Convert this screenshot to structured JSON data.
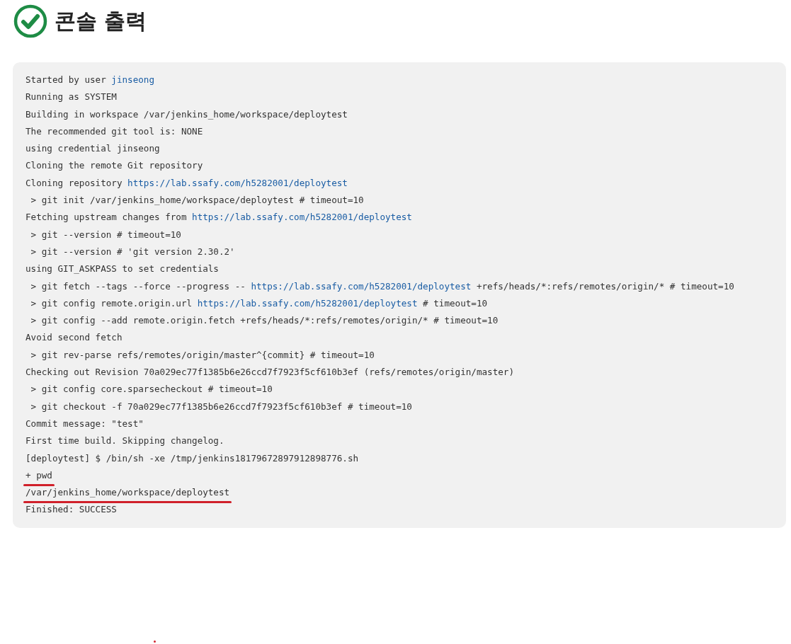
{
  "header": {
    "title": "콘솔 출력",
    "kind": "success"
  },
  "console": {
    "lines": [
      {
        "segments": [
          {
            "kind": "text",
            "text": "Started by user "
          },
          {
            "kind": "link",
            "text": "jinseong"
          }
        ],
        "underlined": false
      },
      {
        "segments": [
          {
            "kind": "text",
            "text": "Running as SYSTEM"
          }
        ],
        "underlined": false
      },
      {
        "segments": [
          {
            "kind": "text",
            "text": "Building in workspace /var/jenkins_home/workspace/deploytest"
          }
        ],
        "underlined": false
      },
      {
        "segments": [
          {
            "kind": "text",
            "text": "The recommended git tool is: NONE"
          }
        ],
        "underlined": false
      },
      {
        "segments": [
          {
            "kind": "text",
            "text": "using credential jinseong"
          }
        ],
        "underlined": false
      },
      {
        "segments": [
          {
            "kind": "text",
            "text": "Cloning the remote Git repository"
          }
        ],
        "underlined": false
      },
      {
        "segments": [
          {
            "kind": "text",
            "text": "Cloning repository "
          },
          {
            "kind": "link",
            "text": "https://lab.ssafy.com/h5282001/deploytest"
          }
        ],
        "underlined": false
      },
      {
        "segments": [
          {
            "kind": "text",
            "text": " > git init /var/jenkins_home/workspace/deploytest # timeout=10"
          }
        ],
        "underlined": false
      },
      {
        "segments": [
          {
            "kind": "text",
            "text": "Fetching upstream changes from "
          },
          {
            "kind": "link",
            "text": "https://lab.ssafy.com/h5282001/deploytest"
          }
        ],
        "underlined": false
      },
      {
        "segments": [
          {
            "kind": "text",
            "text": " > git --version # timeout=10"
          }
        ],
        "underlined": false
      },
      {
        "segments": [
          {
            "kind": "text",
            "text": " > git --version # 'git version 2.30.2'"
          }
        ],
        "underlined": false
      },
      {
        "segments": [
          {
            "kind": "text",
            "text": "using GIT_ASKPASS to set credentials"
          }
        ],
        "underlined": false
      },
      {
        "segments": [
          {
            "kind": "text",
            "text": " > git fetch --tags --force --progress -- "
          },
          {
            "kind": "link",
            "text": "https://lab.ssafy.com/h5282001/deploytest"
          },
          {
            "kind": "text",
            "text": " +refs/heads/*:refs/remotes/origin/* # timeout=10"
          }
        ],
        "underlined": false
      },
      {
        "segments": [
          {
            "kind": "text",
            "text": " > git config remote.origin.url "
          },
          {
            "kind": "link",
            "text": "https://lab.ssafy.com/h5282001/deploytest"
          },
          {
            "kind": "text",
            "text": " # timeout=10"
          }
        ],
        "underlined": false
      },
      {
        "segments": [
          {
            "kind": "text",
            "text": " > git config --add remote.origin.fetch +refs/heads/*:refs/remotes/origin/* # timeout=10"
          }
        ],
        "underlined": false
      },
      {
        "segments": [
          {
            "kind": "text",
            "text": "Avoid second fetch"
          }
        ],
        "underlined": false
      },
      {
        "segments": [
          {
            "kind": "text",
            "text": " > git rev-parse refs/remotes/origin/master^{commit} # timeout=10"
          }
        ],
        "underlined": false
      },
      {
        "segments": [
          {
            "kind": "text",
            "text": "Checking out Revision 70a029ec77f1385b6e26ccd7f7923f5cf610b3ef (refs/remotes/origin/master)"
          }
        ],
        "underlined": false
      },
      {
        "segments": [
          {
            "kind": "text",
            "text": " > git config core.sparsecheckout # timeout=10"
          }
        ],
        "underlined": false
      },
      {
        "segments": [
          {
            "kind": "text",
            "text": " > git checkout -f 70a029ec77f1385b6e26ccd7f7923f5cf610b3ef # timeout=10"
          }
        ],
        "underlined": false
      },
      {
        "segments": [
          {
            "kind": "text",
            "text": "Commit message: \"test\""
          }
        ],
        "underlined": false
      },
      {
        "segments": [
          {
            "kind": "text",
            "text": "First time build. Skipping changelog."
          }
        ],
        "underlined": false
      },
      {
        "segments": [
          {
            "kind": "text",
            "text": "[deploytest] $ /bin/sh -xe /tmp/jenkins18179672897912898776.sh"
          }
        ],
        "underlined": false
      },
      {
        "segments": [
          {
            "kind": "text",
            "text": "+ pwd"
          }
        ],
        "underlined": true
      },
      {
        "segments": [
          {
            "kind": "text",
            "text": "/var/jenkins_home/workspace/deploytest"
          }
        ],
        "underlined": true
      },
      {
        "segments": [
          {
            "kind": "text",
            "text": "Finished: SUCCESS"
          }
        ],
        "underlined": false
      }
    ]
  }
}
